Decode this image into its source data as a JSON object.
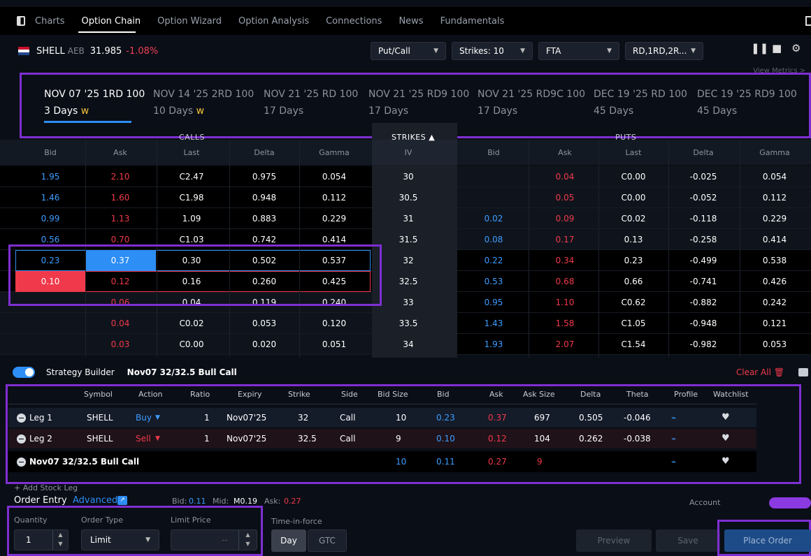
{
  "nav": {
    "tabs": [
      "Charts",
      "Option Chain",
      "Option Wizard",
      "Option Analysis",
      "Connections",
      "News",
      "Fundamentals"
    ],
    "active": "Option Chain"
  },
  "ticker": {
    "symbol": "SHELL",
    "exchange": "AEB",
    "price": "31.985",
    "change": "-1.08%"
  },
  "filters": {
    "view": "Put/Call",
    "strikes": "Strikes: 10",
    "exchange": "FTA",
    "classes": "RD,1RD,2R..."
  },
  "view_metrics": "View Metrics >",
  "expiries": [
    {
      "date": "NOV 07 '25 1RD 100",
      "days": "3 Days",
      "weekly": "w"
    },
    {
      "date": "NOV 14 '25 2RD 100",
      "days": "10 Days",
      "weekly": "w"
    },
    {
      "date": "NOV 21 '25 RD 100",
      "days": "17 Days",
      "weekly": ""
    },
    {
      "date": "NOV 21 '25 RD9 100",
      "days": "17 Days",
      "weekly": ""
    },
    {
      "date": "NOV 21 '25 RD9C 100",
      "days": "17 Days",
      "weekly": ""
    },
    {
      "date": "DEC 19 '25 RD 100",
      "days": "45 Days",
      "weekly": ""
    },
    {
      "date": "DEC 19 '25 RD9 100",
      "days": "45 Days",
      "weekly": ""
    }
  ],
  "chain": {
    "calls_label": "CALLS",
    "strikes_label": "STRIKES",
    "puts_label": "PUTS",
    "headers": [
      "Bid",
      "Ask",
      "Last",
      "Delta",
      "Gamma",
      "IV",
      "Bid",
      "Ask",
      "Last",
      "Delta",
      "Gamma"
    ],
    "rows": [
      {
        "cb": "1.95",
        "ca": "2.10",
        "cl": "C2.47",
        "cd": "0.975",
        "cg": "0.054",
        "k": "30",
        "pb": "",
        "pa": "0.04",
        "pl": "C0.00",
        "pd": "-0.025",
        "pg": "0.054"
      },
      {
        "cb": "1.46",
        "ca": "1.60",
        "cl": "C1.98",
        "cd": "0.948",
        "cg": "0.112",
        "k": "30.5",
        "pb": "",
        "pa": "0.05",
        "pl": "C0.00",
        "pd": "-0.052",
        "pg": "0.112"
      },
      {
        "cb": "0.99",
        "ca": "1.13",
        "cl": "1.09",
        "cd": "0.883",
        "cg": "0.229",
        "k": "31",
        "pb": "0.02",
        "pa": "0.09",
        "pl": "C0.02",
        "pd": "-0.118",
        "pg": "0.229"
      },
      {
        "cb": "0.56",
        "ca": "0.70",
        "cl": "C1.03",
        "cd": "0.742",
        "cg": "0.414",
        "k": "31.5",
        "pb": "0.08",
        "pa": "0.17",
        "pl": "0.13",
        "pd": "-0.258",
        "pg": "0.414"
      },
      {
        "cb": "0.23",
        "ca": "0.37",
        "cl": "0.30",
        "cd": "0.502",
        "cg": "0.537",
        "k": "32",
        "pb": "0.22",
        "pa": "0.34",
        "pl": "0.23",
        "pd": "-0.499",
        "pg": "0.538"
      },
      {
        "cb": "0.10",
        "ca": "0.12",
        "cl": "0.16",
        "cd": "0.260",
        "cg": "0.425",
        "k": "32.5",
        "pb": "0.53",
        "pa": "0.68",
        "pl": "0.66",
        "pd": "-0.741",
        "pg": "0.426"
      },
      {
        "cb": "",
        "ca": "0.06",
        "cl": "0.04",
        "cd": "0.119",
        "cg": "0.240",
        "k": "33",
        "pb": "0.95",
        "pa": "1.10",
        "pl": "C0.62",
        "pd": "-0.882",
        "pg": "0.242"
      },
      {
        "cb": "",
        "ca": "0.04",
        "cl": "C0.02",
        "cd": "0.053",
        "cg": "0.120",
        "k": "33.5",
        "pb": "1.43",
        "pa": "1.58",
        "pl": "C1.05",
        "pd": "-0.948",
        "pg": "0.121"
      },
      {
        "cb": "",
        "ca": "0.03",
        "cl": "C0.00",
        "cd": "0.020",
        "cg": "0.051",
        "k": "34",
        "pb": "1.93",
        "pa": "2.07",
        "pl": "C1.54",
        "pd": "-0.982",
        "pg": "0.053"
      }
    ]
  },
  "strategy": {
    "label": "Strategy Builder",
    "name": "Nov07 32/32.5 Bull Call",
    "clear_all": "Clear All",
    "headers": [
      "Symbol",
      "Action",
      "Ratio",
      "Expiry",
      "Strike",
      "Side",
      "Bid Size",
      "Bid",
      "Ask",
      "Ask Size",
      "Delta",
      "Theta",
      "Profile",
      "Watchlist"
    ],
    "legs": [
      {
        "leg": "Leg 1",
        "symbol": "SHELL",
        "action": "Buy",
        "ratio": "1",
        "expiry": "Nov07'25",
        "strike": "32",
        "side": "Call",
        "bid_size": "10",
        "bid": "0.23",
        "ask": "0.37",
        "ask_size": "697",
        "delta": "0.505",
        "theta": "-0.046"
      },
      {
        "leg": "Leg 2",
        "symbol": "SHELL",
        "action": "Sell",
        "ratio": "1",
        "expiry": "Nov07'25",
        "strike": "32.5",
        "side": "Call",
        "bid_size": "9",
        "bid": "0.10",
        "ask": "0.12",
        "ask_size": "104",
        "delta": "0.262",
        "theta": "-0.038"
      }
    ],
    "combo": {
      "name": "Nov07 32/32.5 Bull Call",
      "bid_size": "10",
      "bid": "0.11",
      "ask": "0.27",
      "ask_size": "9"
    },
    "add_stock": "+ Add Stock Leg"
  },
  "order": {
    "title": "Order Entry",
    "advanced": "Advanced",
    "bid_label": "Bid:",
    "bid": "0.11",
    "mid_label": "Mid:",
    "mid": "M0.19",
    "ask_label": "Ask:",
    "ask": "0.27",
    "account_label": "Account",
    "quantity_label": "Quantity",
    "quantity": "1",
    "type_label": "Order Type",
    "type": "Limit",
    "limit_label": "Limit Price",
    "limit": "--",
    "tif_label": "Time-in-force",
    "tif_options": [
      "Day",
      "GTC"
    ],
    "preview": "Preview",
    "save": "Save",
    "place": "Place Order"
  },
  "colors": {
    "accent": "#2d8ef5",
    "sell": "#f0394a",
    "highlight_border": "#7e2fd1"
  }
}
